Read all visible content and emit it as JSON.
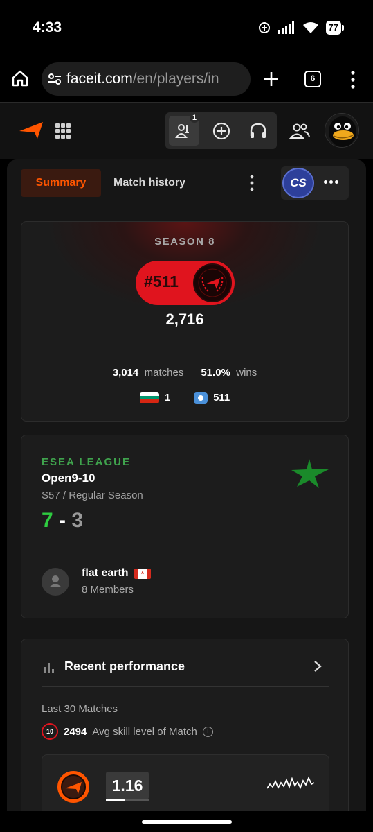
{
  "status_bar": {
    "time": "4:33",
    "battery": "77"
  },
  "browser": {
    "url_host": "faceit.com",
    "url_path": "/en/players/in",
    "tab_count": "6"
  },
  "header": {
    "party_badge": "1"
  },
  "tabs": {
    "summary": "Summary",
    "match_history": "Match history",
    "game": "CS"
  },
  "season": {
    "title": "SEASON 8",
    "rank": "#511",
    "elo": "2,716",
    "matches_value": "3,014",
    "matches_label": "matches",
    "wins_value": "51.0%",
    "wins_label": "wins",
    "country_rank": "1",
    "region_rank": "511"
  },
  "esea": {
    "league": "ESEA LEAGUE",
    "division": "Open9-10",
    "season": "S57 / Regular Season",
    "wins": "7",
    "dash": "-",
    "losses": "3",
    "team_name": "flat earth",
    "team_members": "8 Members"
  },
  "performance": {
    "title": "Recent performance",
    "subtitle": "Last 30 Matches",
    "skill_level": "10",
    "avg_skill": "2494",
    "avg_skill_label": "Avg skill level of Match",
    "kd": "1.16",
    "kd_bar_fraction": 0.45
  },
  "colors": {
    "accent": "#ff5500",
    "rank_red": "#e0141e",
    "esea_green": "#3fa34d",
    "win_green": "#2ecc40"
  }
}
